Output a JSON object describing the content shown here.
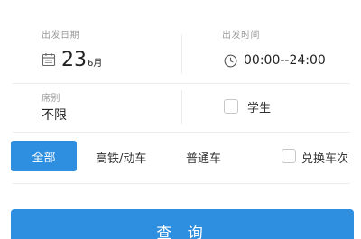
{
  "departure_date": {
    "label": "出发日期",
    "day": "23",
    "month": "6月",
    "icon": "calendar-icon"
  },
  "departure_time": {
    "label": "出发时间",
    "value": "00:00--24:00",
    "icon": "clock-icon"
  },
  "seat_class": {
    "label": "席别",
    "value": "不限"
  },
  "student": {
    "label": "学生",
    "checked": false
  },
  "train_filters": {
    "options": [
      "全部",
      "高铁/动车",
      "普通车"
    ],
    "selected": "全部",
    "swap_label": "兑换车次"
  },
  "query_button": {
    "label": "查 询"
  },
  "colors": {
    "accent": "#2e8ee0",
    "divider": "#ececec",
    "label_gray": "#9a9a9a"
  }
}
